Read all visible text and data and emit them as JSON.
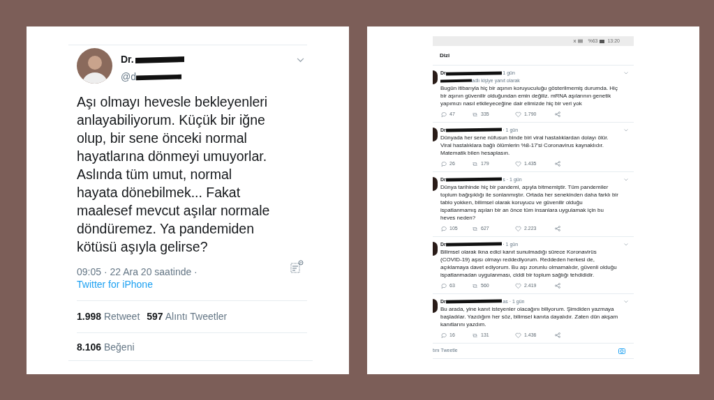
{
  "main_tweet": {
    "name": "Dr.",
    "handle": "@d",
    "text": "Aşı olmayı hevesle bekleyenleri anlayabiliyorum. Küçük bir iğne olup, bir sene önceki normal hayatlarına dönmeyi umuyorlar. Aslında tüm umut, normal hayata dönebilmek... Fakat maalesef mevcut aşılar normale döndüremez. Ya pandemiden kötüsü aşıyla gelirse?",
    "timestamp": "09:05 · 22 Ara 20 saatinde · ",
    "source": "Twitter for iPhone",
    "retweets": "1.998",
    "retweets_label": "Retweet",
    "quotes": "597",
    "quotes_label": "Alıntı Tweetler",
    "likes": "8.106",
    "likes_label": "Beğeni"
  },
  "thread": {
    "status_bar": {
      "battery": "%63",
      "time": "13:20"
    },
    "title": "Dizi",
    "replies": [
      {
        "name": "Dr.",
        "meta": "1 gün",
        "reply_to": "adlı kişiye yanıt olarak",
        "text": "Bugün itibarıyla hiç bir aşının koruyuculuğu gösterilmemiş durumda. Hiç bir aşının güvenilir olduğundan emin değiliz. mRNA aşılarının genetik yapımızı nasıl etkileyeceğine dair elimizde hiç bir veri yok",
        "replies": "47",
        "retweets": "335",
        "likes": "1.790"
      },
      {
        "name": "Dr.",
        "meta": "· 1 gün",
        "text": "Dünyada her sene nüfusun binde biri viral hastalıklardan dolayı ölür. Viral hastalıklara bağlı ölümlerin %8-17'si Coronavirus kaynaklıdır. Matematik bilen hesaplasın.",
        "replies": "26",
        "retweets": "179",
        "likes": "1.435"
      },
      {
        "name": "Dr.",
        "meta": "s · 1 gün",
        "text": "Dünya tarihinde hiç bir pandemi, aşıyla bitmemiştir. Tüm pandemiler toplum bağışıklığı ile sonlanmıştır. Ortada her senekinden daha farklı bir tablo yokken, bilimsel olarak koruyucu ve güvenilir olduğu ispatlanmamış aşıları bir an önce tüm insanlara uygulamak için bu heves neden?",
        "replies": "105",
        "retweets": "627",
        "likes": "2.223"
      },
      {
        "name": "Dr.",
        "meta": "· 1 gün",
        "text": "Bilimsel olarak ikna edici kanıt sunulmadığı sürece Koronavirüs (COVID-19) aşısı olmayı reddediyorum. Reddeden herkesi de, açıklamaya davet ediyorum. Bu aşı zorunlu olmamalıdır, güvenli olduğu ispatlanmadan uygulanması, ciddi bir toplum sağlığı tehdididir.",
        "replies": "63",
        "retweets": "560",
        "likes": "2.419"
      },
      {
        "name": "Dr.",
        "meta": "as · 1 gün",
        "text": "Bu arada, yine kanıt isteyenler olacağını biliyorum. Şimdiden yazmaya başladılar. Yazdığım her söz, bilimsel kanıta dayalıdır. Zaten dün akşam kanıtlarını yazdım.",
        "replies": "16",
        "retweets": "131",
        "likes": "1.436"
      }
    ],
    "compose_placeholder": "tını Tweetle"
  }
}
